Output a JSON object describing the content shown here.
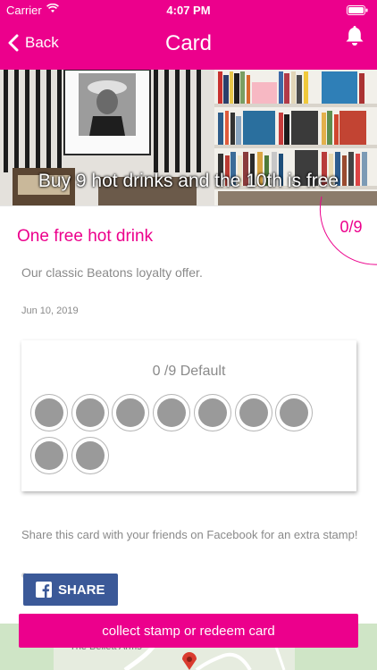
{
  "status_bar": {
    "carrier": "Carrier",
    "time": "4:07 PM"
  },
  "nav": {
    "back_label": "Back",
    "title": "Card"
  },
  "hero": {
    "caption": "Buy 9 hot drinks and the 10th is free"
  },
  "card": {
    "progress": "0/9",
    "title": "One free hot drink",
    "description": "Our classic Beatons loyalty offer.",
    "date": "Jun 10, 2019"
  },
  "stamps": {
    "label": "0 /9 Default",
    "total": 9,
    "collected": 0
  },
  "share": {
    "text": "Share this card with your friends on Facebook for an extra stamp!",
    "button_label": "SHARE"
  },
  "map": {
    "label": "The Bellett Arms"
  },
  "action": {
    "label": "collect stamp or redeem card"
  },
  "colors": {
    "accent": "#ec008c",
    "facebook": "#3b5998",
    "text_muted": "#8a8a8a"
  },
  "icons": {
    "back": "chevron-left-icon",
    "notifications": "bell-icon",
    "share": "facebook-icon",
    "wifi": "wifi-icon",
    "battery": "battery-icon"
  }
}
